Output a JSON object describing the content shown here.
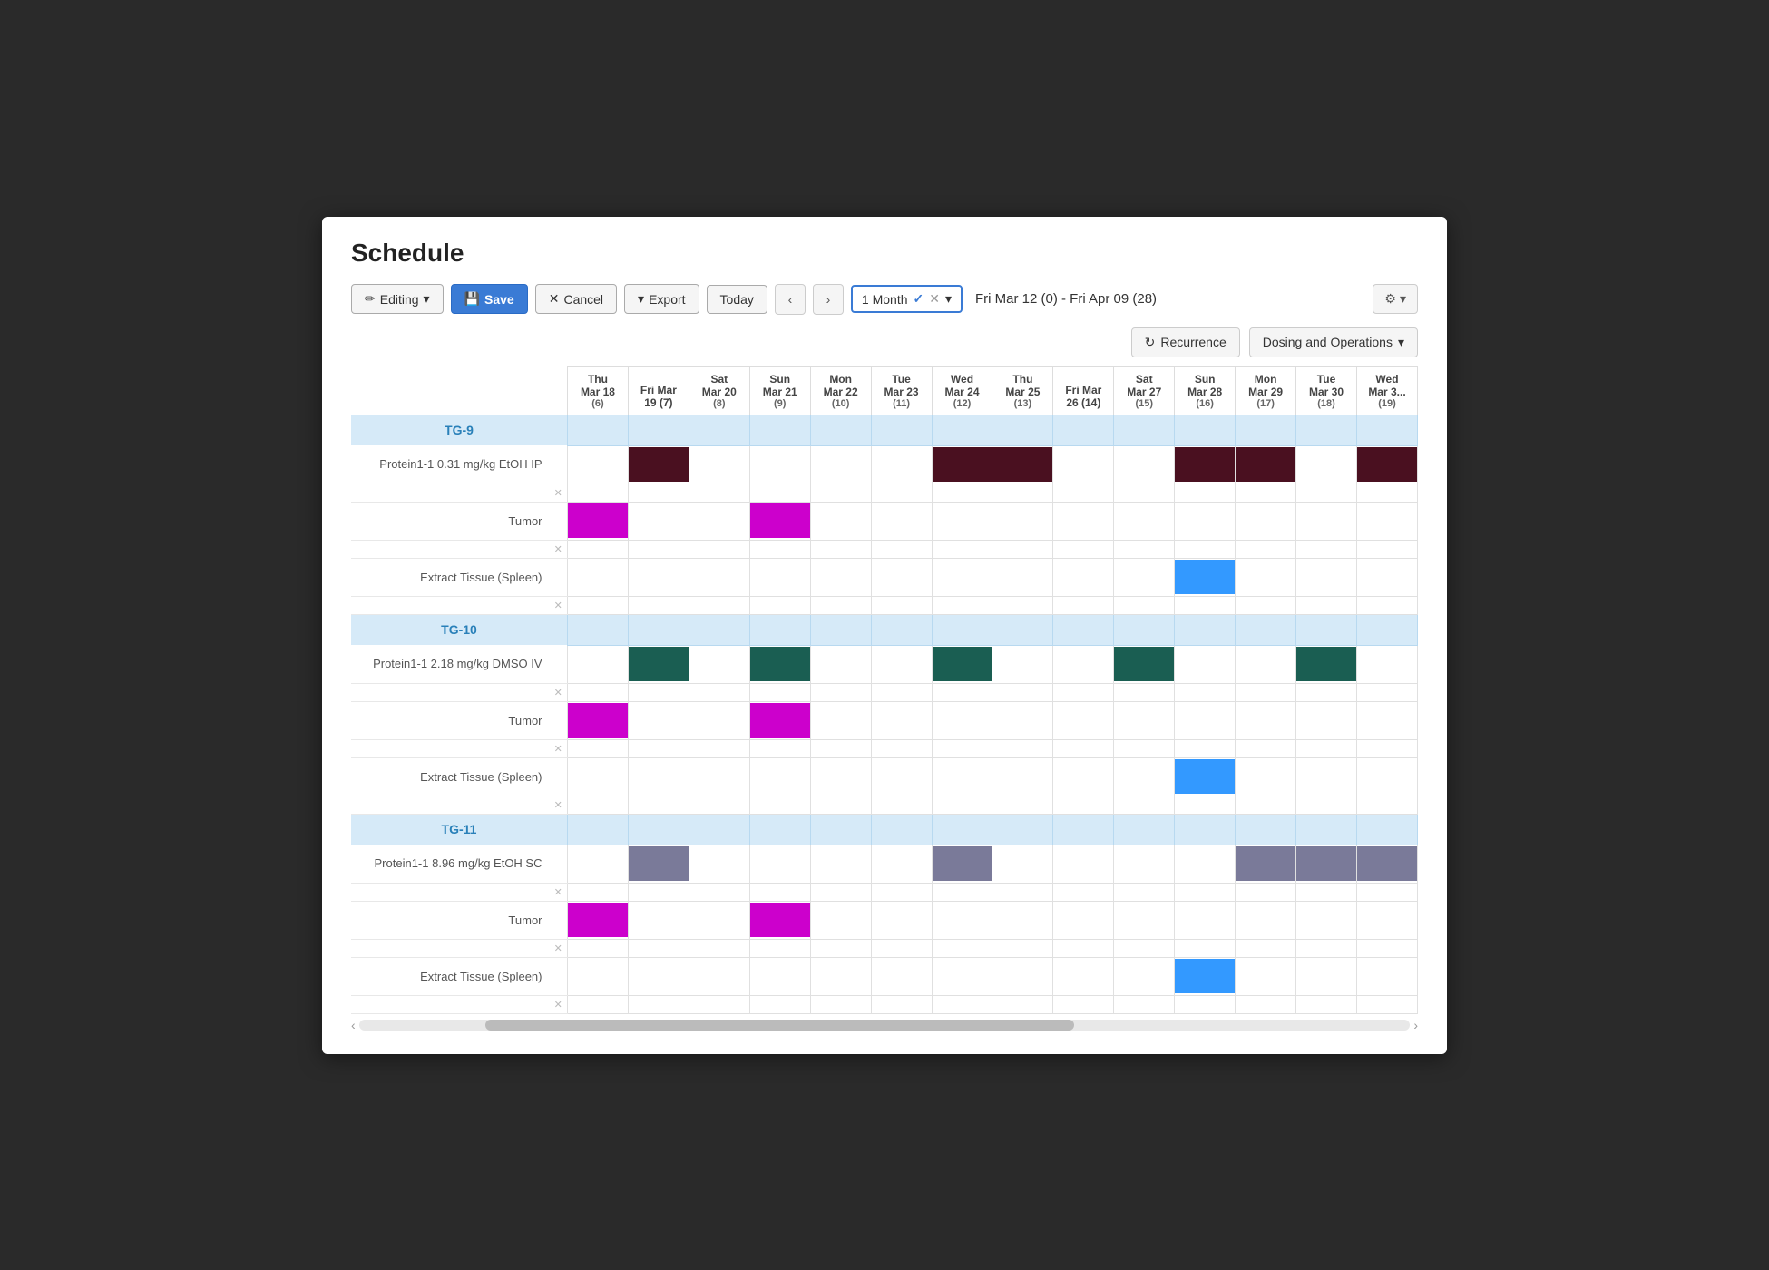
{
  "page": {
    "title": "Schedule"
  },
  "toolbar": {
    "editing_label": "Editing",
    "save_label": "Save",
    "cancel_label": "Cancel",
    "export_label": "Export",
    "today_label": "Today",
    "month_label": "1 Month",
    "date_range": "Fri Mar 12 (0) - Fri Apr 09 (28)",
    "recurrence_label": "Recurrence",
    "dosing_label": "Dosing and Operations"
  },
  "columns": [
    {
      "day": "Thu",
      "date": "Mar 18",
      "num": "(6)"
    },
    {
      "day": "Fri Mar",
      "date": "19 (7)",
      "num": ""
    },
    {
      "day": "Sat",
      "date": "Mar 20",
      "num": "(8)"
    },
    {
      "day": "Sun",
      "date": "Mar 21",
      "num": "(9)"
    },
    {
      "day": "Mon",
      "date": "Mar 22",
      "num": "(10)"
    },
    {
      "day": "Tue",
      "date": "Mar 23",
      "num": "(11)"
    },
    {
      "day": "Wed",
      "date": "Mar 24",
      "num": "(12)"
    },
    {
      "day": "Thu",
      "date": "Mar 25",
      "num": "(13)"
    },
    {
      "day": "Fri Mar",
      "date": "26 (14)",
      "num": ""
    },
    {
      "day": "Sat",
      "date": "Mar 27",
      "num": "(15)"
    },
    {
      "day": "Sun",
      "date": "Mar 28",
      "num": "(16)"
    },
    {
      "day": "Mon",
      "date": "Mar 29",
      "num": "(17)"
    },
    {
      "day": "Tue",
      "date": "Mar 30",
      "num": "(18)"
    },
    {
      "day": "Wed",
      "date": "Mar 3...",
      "num": "(19)"
    }
  ],
  "groups": [
    {
      "id": "TG-9",
      "color": "#2980b9",
      "rows": [
        {
          "label": "Protein1-1 0.31 mg/kg EtOH IP",
          "cells": [
            false,
            true,
            false,
            false,
            false,
            false,
            true,
            true,
            false,
            false,
            true,
            true,
            false,
            true
          ],
          "cell_color": "cell-dark-red"
        },
        {
          "label": "Tumor",
          "cells": [
            true,
            false,
            false,
            true,
            false,
            false,
            false,
            false,
            false,
            false,
            false,
            false,
            false,
            false
          ],
          "cell_color": "cell-purple"
        },
        {
          "label": "Extract Tissue (Spleen)",
          "cells": [
            false,
            false,
            false,
            false,
            false,
            false,
            false,
            false,
            false,
            false,
            true,
            false,
            false,
            false
          ],
          "cell_color": "cell-blue"
        }
      ]
    },
    {
      "id": "TG-10",
      "color": "#2980b9",
      "rows": [
        {
          "label": "Protein1-1 2.18 mg/kg DMSO IV",
          "cells": [
            false,
            true,
            false,
            true,
            false,
            false,
            true,
            false,
            false,
            true,
            false,
            false,
            true,
            false
          ],
          "cell_color": "cell-teal"
        },
        {
          "label": "Tumor",
          "cells": [
            true,
            false,
            false,
            true,
            false,
            false,
            false,
            false,
            false,
            false,
            false,
            false,
            false,
            false
          ],
          "cell_color": "cell-purple"
        },
        {
          "label": "Extract Tissue (Spleen)",
          "cells": [
            false,
            false,
            false,
            false,
            false,
            false,
            false,
            false,
            false,
            false,
            true,
            false,
            false,
            false
          ],
          "cell_color": "cell-blue"
        }
      ]
    },
    {
      "id": "TG-11",
      "color": "#2980b9",
      "rows": [
        {
          "label": "Protein1-1 8.96 mg/kg EtOH SC",
          "cells": [
            false,
            true,
            false,
            false,
            false,
            false,
            true,
            false,
            false,
            false,
            false,
            true,
            true,
            true
          ],
          "cell_color": "cell-gray-purple"
        },
        {
          "label": "Tumor",
          "cells": [
            true,
            false,
            false,
            true,
            false,
            false,
            false,
            false,
            false,
            false,
            false,
            false,
            false,
            false
          ],
          "cell_color": "cell-purple"
        },
        {
          "label": "Extract Tissue (Spleen)",
          "cells": [
            false,
            false,
            false,
            false,
            false,
            false,
            false,
            false,
            false,
            false,
            true,
            false,
            false,
            false
          ],
          "cell_color": "cell-blue"
        }
      ]
    }
  ],
  "icons": {
    "pencil": "✏",
    "save": "💾",
    "cancel": "✕",
    "export_arrow": "▾",
    "prev_arrow": "‹",
    "next_arrow": "›",
    "check": "✓",
    "x": "✕",
    "dropdown": "▾",
    "recurrence": "↻",
    "gear": "⚙",
    "scroll_left": "‹",
    "scroll_right": "›"
  }
}
